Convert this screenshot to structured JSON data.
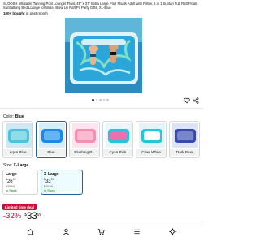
{
  "product": {
    "title": "SLOOSH Inflatable Tanning Pool Lounger Float, 49\" x 37\" Extra Large Pool Floats Adult with Pillow, 6 in 1 Suntan Tub Raft Floats Sunbathing Bed Lounge for Water Blow Up Raft Pit Party Gifts, XL-Blue",
    "bought_bold": "100+ bought",
    "bought_rest": " in past month"
  },
  "gallery": {
    "dots": 5,
    "active_dot": 0
  },
  "actions": {
    "wishlist_icon": "heart-icon",
    "share_icon": "share-icon"
  },
  "color": {
    "label": "Color: ",
    "selected": "Blue",
    "options": [
      {
        "label": "Aqua Blue",
        "color": "#4fc3d9"
      },
      {
        "label": "Blue",
        "color": "#1e88e5"
      },
      {
        "label": "Blushing P...",
        "color": "#f48fb1"
      },
      {
        "label": "Cyan Pink",
        "color": "#ec6fb0"
      },
      {
        "label": "Cyan White",
        "color": "#26c6da"
      },
      {
        "label": "Dark Blue",
        "color": "#3949ab"
      }
    ]
  },
  "size": {
    "label": "Size: ",
    "selected": "X-Large",
    "options": [
      {
        "name": "Large",
        "currency": "$",
        "whole": "26",
        "fraction": "99",
        "was": "$39.99",
        "stock": "In Stock"
      },
      {
        "name": "X-Large",
        "currency": "$",
        "whole": "33",
        "fraction": "99",
        "was": "$49.99",
        "stock": "In Stock"
      }
    ]
  },
  "deal": {
    "badge": "Limited time deal",
    "discount": "-32%",
    "currency": "$",
    "whole": "33",
    "fraction": "99"
  },
  "colors": {
    "deal_red": "#cc0c39",
    "selection_blue": "#2162a1",
    "in_stock_green": "#007600"
  },
  "nav": [
    "home-icon",
    "profile-icon",
    "cart-icon",
    "menu-icon",
    "assistant-icon"
  ]
}
